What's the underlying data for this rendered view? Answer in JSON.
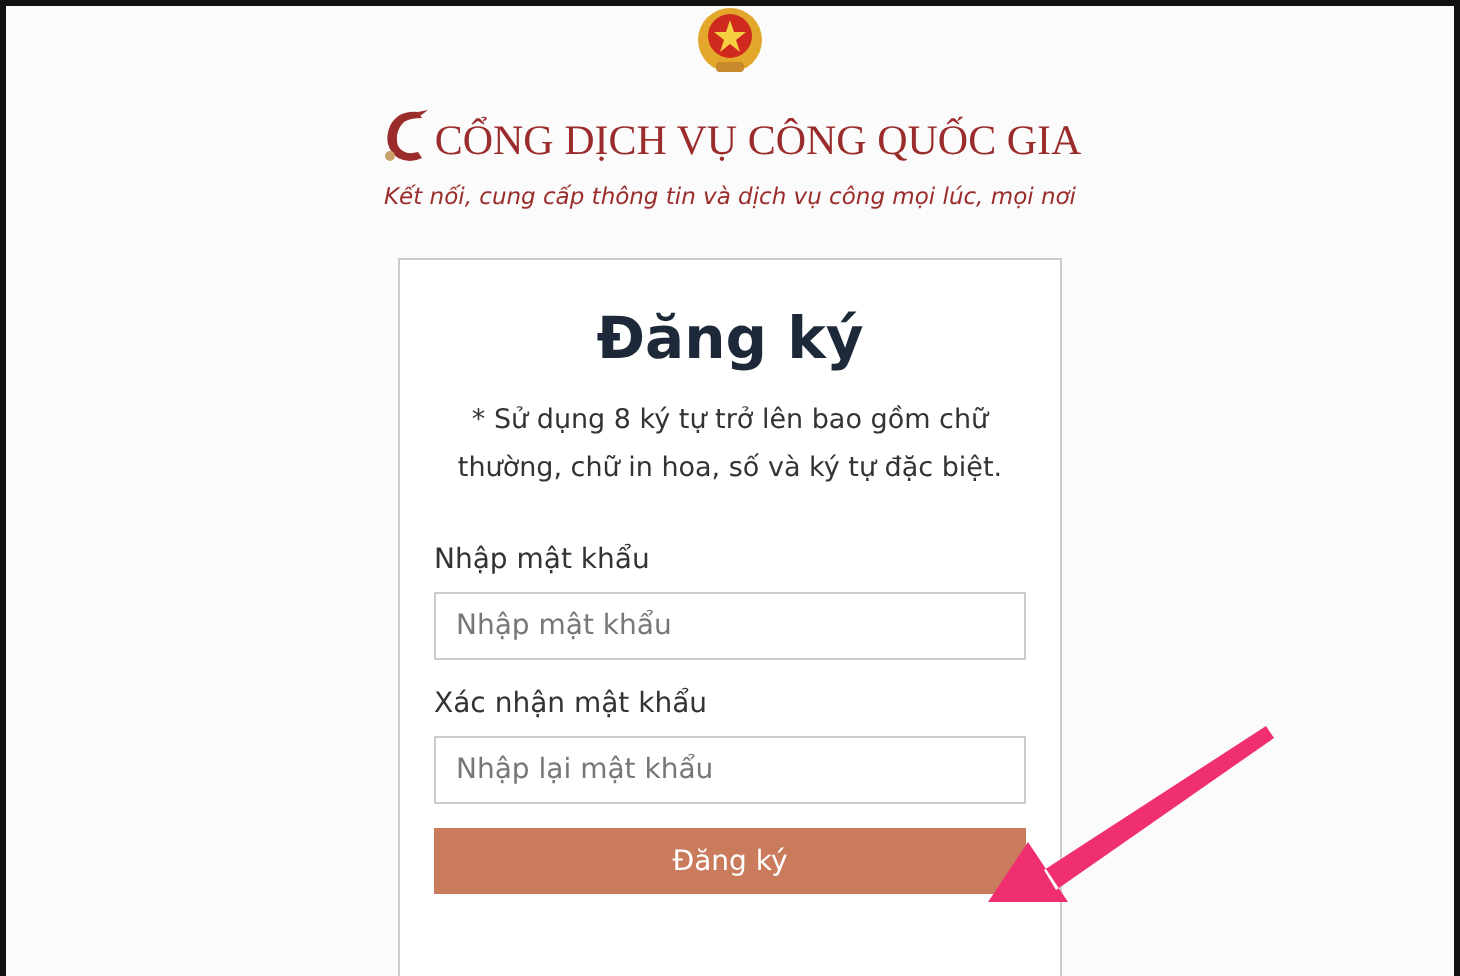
{
  "header": {
    "title": "CỔNG DỊCH VỤ CÔNG QUỐC GIA",
    "tagline": "Kết nối, cung cấp thông tin và dịch vụ công mọi lúc, mọi nơi"
  },
  "form": {
    "heading": "Đăng ký",
    "note": "* Sử dụng 8 ký tự trở lên bao gồm chữ thường, chữ in hoa, số và ký tự đặc biệt.",
    "fields": [
      {
        "label": "Nhập mật khẩu",
        "placeholder": "Nhập mật khẩu"
      },
      {
        "label": "Xác nhận mật khẩu",
        "placeholder": "Nhập lại mật khẩu"
      }
    ],
    "submit": "Đăng ký"
  }
}
